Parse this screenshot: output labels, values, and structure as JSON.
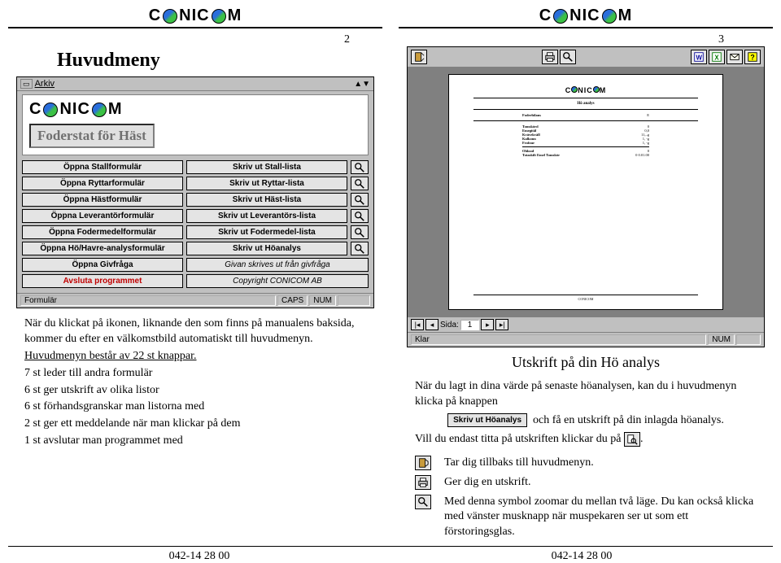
{
  "brand": "CONICOM",
  "page_left_num": "2",
  "page_right_num": "3",
  "left": {
    "heading": "Huvudmeny",
    "window": {
      "menu_label": "Arkiv",
      "product_title": "Foderstat för Häst",
      "rows": [
        {
          "open": "Öppna Stallformulär",
          "print": "Skriv ut Stall-lista",
          "mag": true
        },
        {
          "open": "Öppna Ryttarformulär",
          "print": "Skriv ut Ryttar-lista",
          "mag": true
        },
        {
          "open": "Öppna Hästformulär",
          "print": "Skriv ut Häst-lista",
          "mag": true
        },
        {
          "open": "Öppna Leverantörformulär",
          "print": "Skriv ut Leverantörs-lista",
          "mag": true
        },
        {
          "open": "Öppna Fodermedelformulär",
          "print": "Skriv ut Fodermedel-lista",
          "mag": true
        },
        {
          "open": "Öppna Hö/Havre-analysformulär",
          "print": "Skriv ut Höanalys",
          "mag": true
        },
        {
          "open": "Öppna Givfråga",
          "print": "Givan skrives ut från givfråga",
          "mag": false,
          "print_italic": true
        }
      ],
      "quit_label": "Avsluta programmet",
      "copyright_label": "Copyright CONICOM AB",
      "status_left": "Formulär",
      "status_caps": "CAPS",
      "status_num": "NUM"
    },
    "prose": {
      "p1": "När du klickat på ikonen, liknande den som finns på manualens baksida, kommer du efter en välkomstbild automatiskt till huvudmenyn.",
      "p2": "Huvudmenyn består av 22 st knappar.",
      "p3a": "7 st leder till andra formulär",
      "p3b": "6 st ger utskrift av olika listor",
      "p3c": "6 st förhandsgranskar man listorna med",
      "p3d": "2 st ger ett meddelande när man klickar på dem",
      "p3e": "1 st avslutar man programmet med"
    }
  },
  "right": {
    "preview": {
      "page_label": "Sida:",
      "page_value": "1",
      "status_ready": "Klar",
      "status_num": "NUM",
      "doc_heading": "Hö analys",
      "doc_field": "Foderbilans",
      "doc_field_val": "E",
      "tbl": [
        {
          "k": "Tomskörd",
          "v": "0"
        },
        {
          "k": "Emegitål",
          "v": "0,0"
        },
        {
          "k": "Kvävekväll",
          "v": "11,–g"
        },
        {
          "k": "Kalkonn",
          "v": "1, -g"
        },
        {
          "k": "Frofour",
          "v": "1, -g"
        },
        {
          "k": "Ohlood",
          "v": "0"
        },
        {
          "k": "Totaskilt Emel Tomskör",
          "v": "0   0.01.00"
        }
      ]
    },
    "title": "Utskrift på din Hö analys",
    "p1a": "När du lagt in dina värde på senaste höanalysen, kan du i huvudmenyn klicka på knappen",
    "p1_btn": "Skriv ut Höanalys",
    "p1b": "och få en utskrift på din inlagda höanalys.",
    "p2a": "Vill du endast titta på utskriften klickar du på",
    "icon_rows": [
      {
        "icon": "door",
        "text": "Tar dig tillbaks till huvudmenyn."
      },
      {
        "icon": "printer",
        "text": "Ger dig en utskrift."
      },
      {
        "icon": "magnifier",
        "text": "Med denna symbol zoomar du mellan två läge.\nDu kan också klicka med vänster musknapp när muspekaren ser ut som ett förstoringsglas."
      }
    ]
  },
  "footer_phone": "042-14 28 00"
}
